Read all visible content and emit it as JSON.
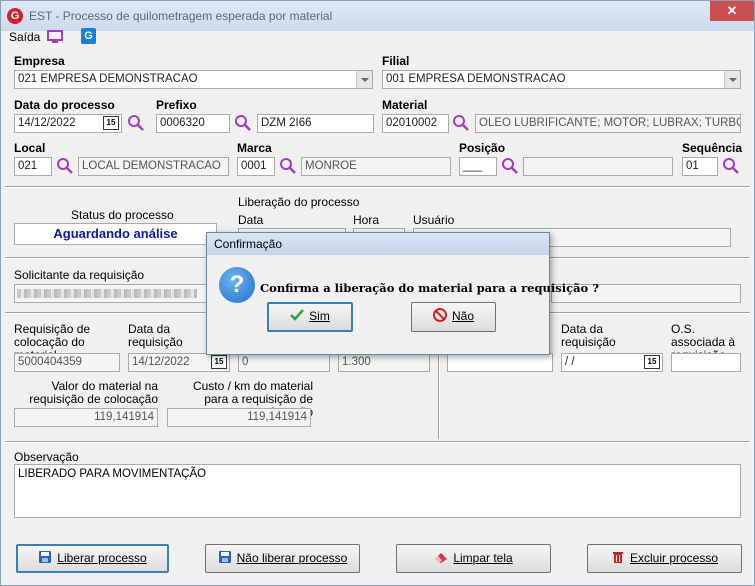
{
  "window": {
    "title": "EST - Processo de quilometragem esperada por material",
    "close": "✕"
  },
  "menu": {
    "saida": "Saída"
  },
  "form": {
    "empresa": {
      "label": "Empresa",
      "value": "021 EMPRESA DEMONSTRACAO"
    },
    "filial": {
      "label": "Filial",
      "value": "001 EMPRESA DEMONSTRACAO"
    },
    "data_processo": {
      "label": "Data do processo",
      "value": "14/12/2022"
    },
    "prefixo": {
      "label": "Prefixo",
      "code": "0006320",
      "desc": "DZM 2I66"
    },
    "material": {
      "label": "Material",
      "code": "02010002",
      "desc": "OLEO LUBRIFICANTE; MOTOR; LUBRAX; TURBO"
    },
    "local": {
      "label": "Local",
      "code": "021",
      "desc": "LOCAL DEMONSTRACAO"
    },
    "marca": {
      "label": "Marca",
      "code": "0001",
      "desc": "MONROE"
    },
    "posicao": {
      "label": "Posição",
      "code": "___",
      "desc": ""
    },
    "sequencia": {
      "label": "Sequência",
      "code": "01"
    }
  },
  "status": {
    "label": "Status do processo",
    "value": "Aguardando análise"
  },
  "liberacao": {
    "label": "Liberação do processo",
    "data": "Data",
    "hora": "Hora",
    "usuario": "Usuário"
  },
  "solicitante": {
    "label": "Solicitante da requisição"
  },
  "req_colocacao": {
    "req_label": "Requisição de colocação do material",
    "req_value": "5000404359",
    "data_label": "Data da requisição",
    "data_value": "14/12/2022",
    "qtd_value": "0",
    "qtd2_value": "1.300",
    "valor_label": "Valor do material na requisição de colocação",
    "valor_value": "119,141914",
    "custo_label": "Custo / km do material para a requisição de colocação",
    "custo_value": "119,141914"
  },
  "req_retirada": {
    "data_label": "Data da requisição",
    "data_value": " /  /",
    "os_label": "O.S. associada à requisição"
  },
  "observacao": {
    "label": "Observação",
    "value": "LIBERADO PARA MOVIMENTAÇÃO"
  },
  "buttons": {
    "liberar": "Liberar processo",
    "nao_liberar": "Não liberar processo",
    "limpar": "Limpar tela",
    "excluir": "Excluir processo"
  },
  "dialog": {
    "title": "Confirmação",
    "message": "Confirma a liberação do material para a requisição ?",
    "sim": "Sim",
    "nao": "Não"
  },
  "colors": {
    "status_text": "#0a18a8",
    "accent": "#3c7fb1",
    "search_icon": "#a33cc2",
    "danger": "#d42020"
  },
  "icons": [
    "app-logo-icon",
    "monitor-icon",
    "g-logo-icon",
    "magnifier-icon",
    "calendar-icon",
    "save-icon",
    "eraser-icon",
    "trash-icon",
    "check-icon",
    "stop-icon",
    "question-icon"
  ]
}
